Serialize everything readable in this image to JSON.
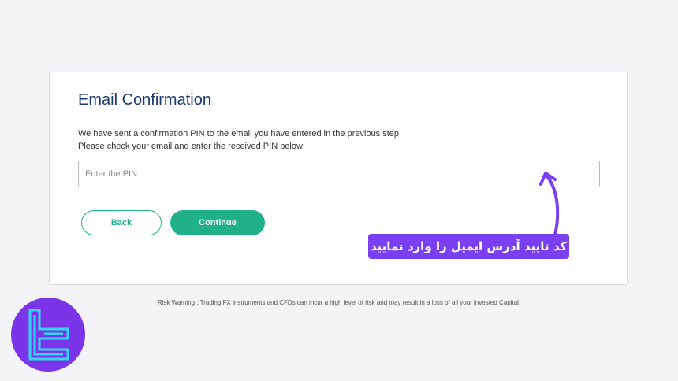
{
  "form": {
    "title": "Email Confirmation",
    "description_line1": "We have sent a confirmation PIN to the email you have entered in the previous step.",
    "description_line2": "Please check your email and enter the received PIN below:",
    "pin_placeholder": "Enter the PIN",
    "pin_value": "",
    "back_label": "Back",
    "continue_label": "Continue"
  },
  "annotation": {
    "text": "کد تایید آدرس ایمیل را وارد نمایید"
  },
  "footer": {
    "risk_warning": "Risk Warning : Trading FX instruments and CFDs can incur a high level of risk and may result in a loss of all your invested Capital."
  },
  "colors": {
    "accent_green": "#20b188",
    "title_blue": "#1b3a70",
    "annotation_purple": "#7a3ff0",
    "logo_purple": "#7b35e8",
    "logo_cyan": "#33d6f2"
  },
  "icons": {
    "logo": "tradingfinder-logo-icon",
    "arrow": "curved-arrow-up-icon"
  }
}
